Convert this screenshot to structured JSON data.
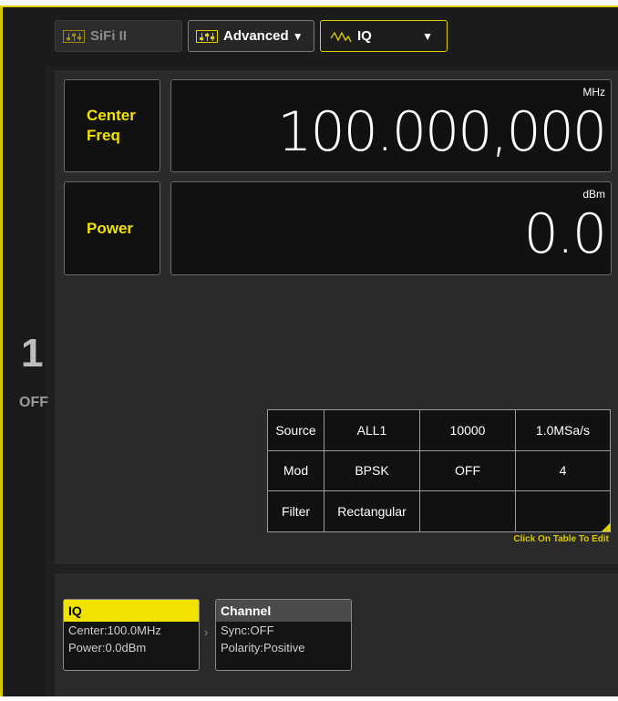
{
  "channel": {
    "number": "1",
    "state": "OFF"
  },
  "tabs": {
    "sifi_label": "SiFi II",
    "advanced_label": "Advanced",
    "iq_label": "IQ"
  },
  "center_freq": {
    "label_line1": "Center",
    "label_line2": "Freq",
    "unit": "MHz",
    "value": "100.000,000"
  },
  "power": {
    "label": "Power",
    "unit": "dBm",
    "value": "0.0"
  },
  "iq_table": {
    "rows": [
      [
        "Source",
        "ALL1",
        "10000",
        "1.0MSa/s"
      ],
      [
        "Mod",
        "BPSK",
        "OFF",
        "4"
      ],
      [
        "Filter",
        "Rectangular",
        "",
        ""
      ]
    ],
    "hint": "Click On Table To Edit"
  },
  "blocks": {
    "iq": {
      "title": "IQ",
      "line1": "Center:100.0MHz",
      "line2": "Power:0.0dBm"
    },
    "channel": {
      "title": "Channel",
      "line1": "Sync:OFF",
      "line2": "Polarity:Positive"
    }
  },
  "colors": {
    "accent": "#f2e200",
    "background": "#1f1f1f",
    "panel": "#2a2a2a"
  },
  "icons": {
    "sifi": "sliders-icon",
    "advanced": "sliders-icon",
    "iq": "wave-icon"
  }
}
